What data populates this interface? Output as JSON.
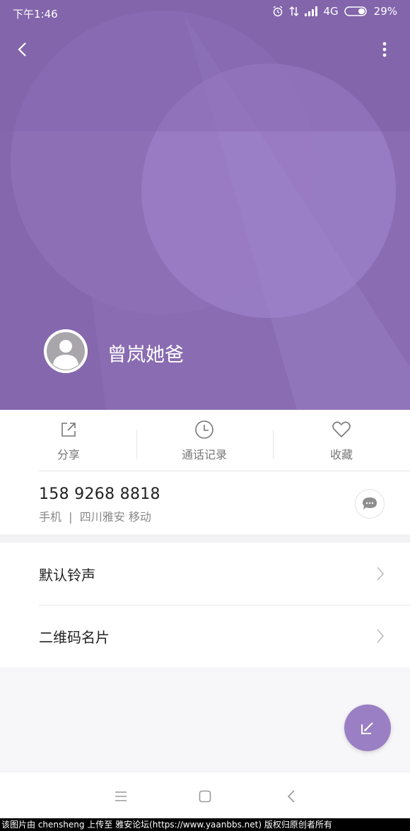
{
  "status_bar": {
    "time": "下午1:46",
    "network": "4G",
    "battery": "29%"
  },
  "contact": {
    "name": "曾岚她爸"
  },
  "actions": [
    {
      "label": "分享",
      "icon": "share-icon"
    },
    {
      "label": "通话记录",
      "icon": "clock-icon"
    },
    {
      "label": "收藏",
      "icon": "heart-icon"
    }
  ],
  "phone": {
    "number": "158 9268 8818",
    "detail": "手机  |  四川雅安 移动"
  },
  "settings": [
    {
      "label": "默认铃声"
    },
    {
      "label": "二维码名片"
    }
  ],
  "watermark": "该图片由 chensheng 上传至 雅安论坛(https://www.yaanbbs.net) 版权归原创者所有",
  "colors": {
    "header": "#8a6db0",
    "fab": "#9a7fc4"
  }
}
